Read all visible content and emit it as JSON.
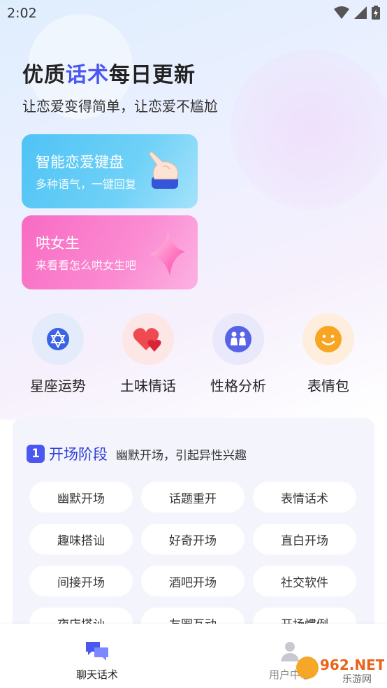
{
  "status": {
    "time": "2:02"
  },
  "header": {
    "title_prefix": "优质",
    "title_accent": "话术",
    "title_suffix": "每日更新",
    "subtitle": "让恋爱变得简单，让恋爱不尴尬"
  },
  "cards": [
    {
      "title": "智能恋爱键盘",
      "desc": "多种语气，一键回复"
    },
    {
      "title": "哄女生",
      "desc": "来看看怎么哄女生吧"
    }
  ],
  "shortcuts": [
    {
      "label": "星座运势",
      "icon": "star-of-david-icon"
    },
    {
      "label": "土味情话",
      "icon": "hearts-icon"
    },
    {
      "label": "性格分析",
      "icon": "people-icon"
    },
    {
      "label": "表情包",
      "icon": "smiley-icon"
    }
  ],
  "stage": {
    "number": "1",
    "name": "开场阶段",
    "desc": "幽默开场，引起异性兴趣"
  },
  "chips": [
    "幽默开场",
    "话题重开",
    "表情话术",
    "趣味搭讪",
    "好奇开场",
    "直白开场",
    "间接开场",
    "酒吧开场",
    "社交软件",
    "夜店搭讪",
    "友圈互动",
    "开场惯例"
  ],
  "tabs": [
    {
      "label": "聊天话术",
      "active": true
    },
    {
      "label": "用户中心",
      "active": false
    }
  ],
  "watermark": {
    "text": "962.NET",
    "sub": "乐游网"
  },
  "colors": {
    "accent": "#4a57f0",
    "blue_card": "#4fc3f5",
    "pink_card": "#f86bc3"
  }
}
